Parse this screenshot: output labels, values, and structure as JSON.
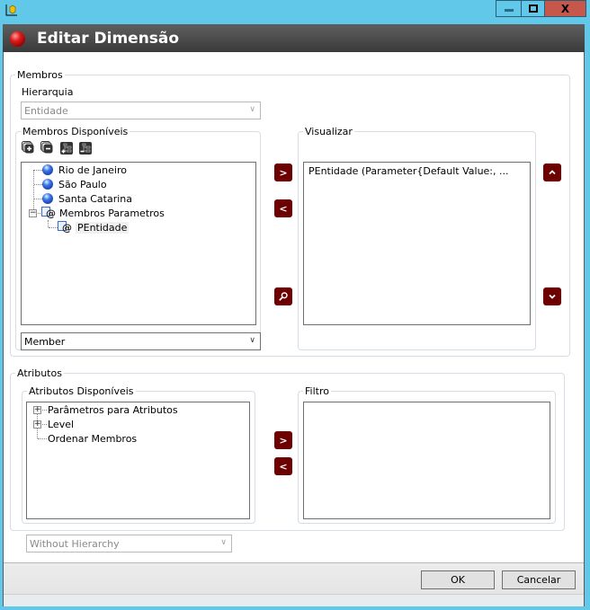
{
  "window": {
    "minimize_label": "minimize",
    "maximize_label": "maximize",
    "close_glyph": "X"
  },
  "dialog": {
    "title": "Editar Dimensão"
  },
  "membros": {
    "legend": "Membros",
    "hierarquia_label": "Hierarquia",
    "hierarquia_value": "Entidade",
    "disponiveis": {
      "legend": "Membros Disponíveis",
      "toolbar": [
        "expand-all-icon",
        "collapse-all-icon",
        "add-node-icon",
        "remove-node-icon"
      ],
      "tree": [
        {
          "label": "Rio de Janeiro",
          "icon": "member-ball-icon"
        },
        {
          "label": "São Paulo",
          "icon": "member-ball-icon"
        },
        {
          "label": "Santa Catarina",
          "icon": "member-ball-icon"
        },
        {
          "label": "Membros Parametros",
          "icon": "parameter-icon",
          "expanded": true,
          "children": [
            {
              "label": "PEntidade",
              "icon": "parameter-icon",
              "selected": true
            }
          ]
        }
      ],
      "type_combo_value": "Member"
    },
    "visualizar": {
      "legend": "Visualizar",
      "items": [
        "PEntidade (Parameter{Default Value:, ..."
      ]
    },
    "buttons": {
      "add": ">",
      "remove": "<",
      "search": "search",
      "move_up": "^",
      "move_down": "v"
    }
  },
  "atributos": {
    "legend": "Atributos",
    "disponiveis": {
      "legend": "Atributos Disponíveis",
      "tree": [
        {
          "label": "Parâmetros para Atributos",
          "expandable": true
        },
        {
          "label": "Level",
          "expandable": true
        },
        {
          "label": "Ordenar Membros",
          "expandable": false
        }
      ]
    },
    "filtro": {
      "legend": "Filtro",
      "items": []
    },
    "buttons": {
      "add": ">",
      "remove": "<"
    }
  },
  "hierarchy_combo_value": "Without Hierarchy",
  "footer": {
    "ok_label": "OK",
    "cancel_label": "Cancelar"
  },
  "colors": {
    "accent": "#6d0000",
    "titlebar_bg": "#62c8ea",
    "close_bg": "#c7574a",
    "header_bg": "#4a4a4a"
  }
}
